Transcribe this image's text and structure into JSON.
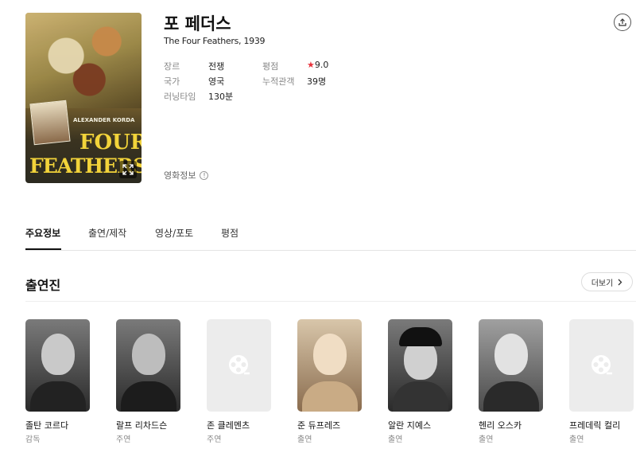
{
  "movie": {
    "title": "포 페더스",
    "subtitle": "The Four Feathers, 1939",
    "poster": {
      "credit": "ALEXANDER KORDA",
      "title_line1": "FOUR",
      "title_line2": "FEATHERS"
    },
    "meta_left": [
      {
        "key": "장르",
        "value": "전쟁"
      },
      {
        "key": "국가",
        "value": "영국"
      },
      {
        "key": "러닝타임",
        "value": "130분"
      }
    ],
    "meta_right": [
      {
        "key": "평점",
        "star": "★",
        "value": "9.0"
      },
      {
        "key": "누적관객",
        "value": "39명"
      }
    ],
    "info_link": "영화정보",
    "info_icon": "!"
  },
  "tabs": [
    "주요정보",
    "출연/제작",
    "영상/포토",
    "평점"
  ],
  "cast_section": {
    "title": "출연진",
    "more_label": "더보기",
    "members": [
      {
        "name": "졸탄 코르다",
        "role": "감독",
        "photo": true
      },
      {
        "name": "랄프 리차드슨",
        "role": "주연",
        "photo": true
      },
      {
        "name": "존 클레멘츠",
        "role": "주연",
        "photo": false
      },
      {
        "name": "준 듀프레즈",
        "role": "출연",
        "photo": true
      },
      {
        "name": "알란 지예스",
        "role": "출연",
        "photo": true
      },
      {
        "name": "헨리 오스카",
        "role": "출연",
        "photo": true
      },
      {
        "name": "프레데릭 컬리",
        "role": "출연",
        "photo": false
      }
    ]
  },
  "colors": {
    "star": "#e8323c",
    "poster_title": "#f2d33a"
  }
}
